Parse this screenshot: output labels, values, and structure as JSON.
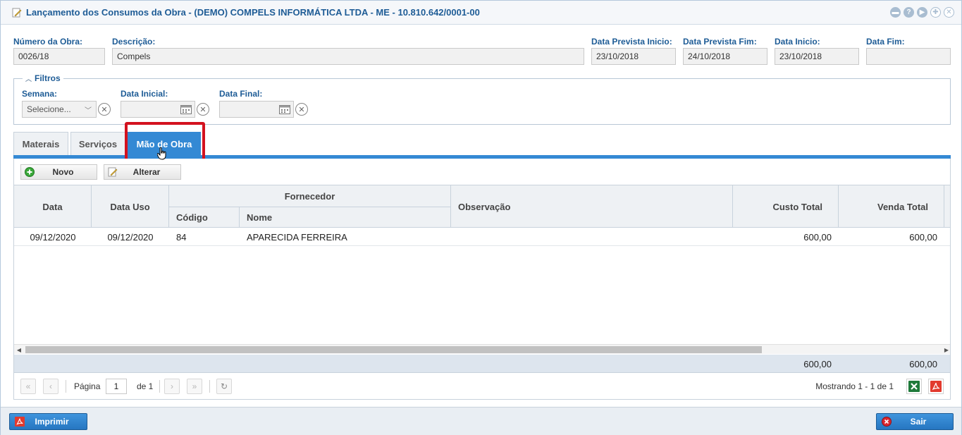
{
  "window": {
    "title": "Lançamento dos Consumos da Obra - (DEMO) COMPELS INFORMÁTICA LTDA - ME - 10.810.642/0001-00",
    "tools": [
      "minimize-icon",
      "help-icon",
      "next-icon",
      "maximize-icon",
      "close-icon"
    ]
  },
  "header": {
    "numero_label": "Número da Obra:",
    "numero_value": "0026/18",
    "descricao_label": "Descrição:",
    "descricao_value": "Compels",
    "prev_inicio_label": "Data Prevista Inicio:",
    "prev_inicio_value": "23/10/2018",
    "prev_fim_label": "Data Prevista Fim:",
    "prev_fim_value": "24/10/2018",
    "inicio_label": "Data Inicio:",
    "inicio_value": "23/10/2018",
    "fim_label": "Data Fim:",
    "fim_value": ""
  },
  "filters": {
    "legend": "Filtros",
    "semana_label": "Semana:",
    "semana_value": "Selecione...",
    "data_inicial_label": "Data Inicial:",
    "data_inicial_value": "",
    "data_final_label": "Data Final:",
    "data_final_value": ""
  },
  "tabs": [
    {
      "label": "Materais",
      "active": false
    },
    {
      "label": "Serviços",
      "active": false
    },
    {
      "label": "Mão de Obra",
      "active": true
    }
  ],
  "toolbar": {
    "novo_label": "Novo",
    "alterar_label": "Alterar"
  },
  "grid": {
    "headers": {
      "data": "Data",
      "data_uso": "Data Uso",
      "fornecedor": "Fornecedor",
      "codigo": "Código",
      "nome": "Nome",
      "observacao": "Observação",
      "custo_total": "Custo Total",
      "venda_total": "Venda Total"
    },
    "rows": [
      {
        "data": "09/12/2020",
        "data_uso": "09/12/2020",
        "codigo": "84",
        "nome": "APARECIDA FERREIRA",
        "observacao": "",
        "custo_total": "600,00",
        "venda_total": "600,00"
      }
    ],
    "totals": {
      "custo_total": "600,00",
      "venda_total": "600,00"
    }
  },
  "pager": {
    "pagina_label": "Página",
    "page": "1",
    "de_label": "de 1",
    "mostrando": "Mostrando 1 - 1 de 1"
  },
  "footer": {
    "imprimir_label": "Imprimir",
    "sair_label": "Sair"
  },
  "colors": {
    "accent": "#3489d4",
    "title": "#1e5c96",
    "highlight": "#d3121f"
  }
}
